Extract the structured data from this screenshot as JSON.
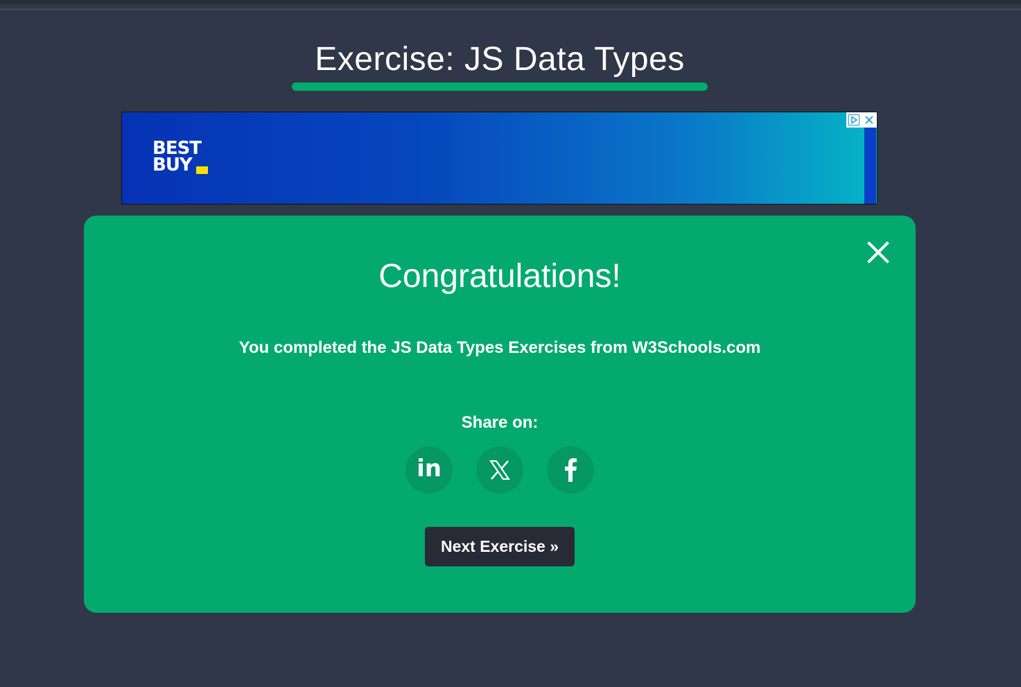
{
  "header": {
    "title": "Exercise: JS Data Types"
  },
  "ad": {
    "logo_line1": "BEST",
    "logo_line2": "BUY",
    "adchoices_icon": "adchoices-icon",
    "close_icon": "close-icon"
  },
  "modal": {
    "title": "Congratulations!",
    "message": "You completed the JS Data Types Exercises from W3Schools.com",
    "share_label": "Share on:",
    "share_buttons": [
      {
        "icon": "linkedin-icon",
        "label": "in"
      },
      {
        "icon": "x-icon"
      },
      {
        "icon": "facebook-icon"
      }
    ],
    "next_button_label": "Next Exercise »",
    "close_icon": "close-icon"
  },
  "colors": {
    "background": "#2f3748",
    "accent_green": "#04aa6d",
    "button_dark": "#282a35",
    "ad_blue": "#0633b5",
    "ad_teal": "#05b5c6"
  }
}
